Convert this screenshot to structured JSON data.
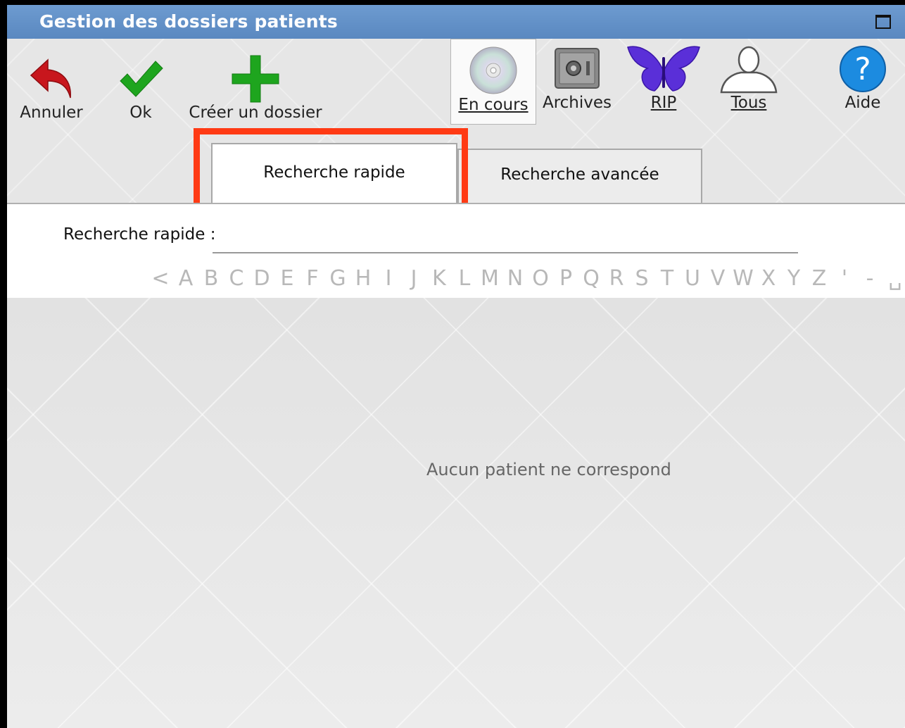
{
  "window": {
    "title": "Gestion des dossiers patients"
  },
  "toolbar": {
    "cancel_label": "Annuler",
    "ok_label": "Ok",
    "create_label": "Créer un dossier",
    "current_label": "En cours",
    "archives_label": "Archives",
    "rip_label": "RIP",
    "all_label": "Tous",
    "help_label": "Aide"
  },
  "tabs": {
    "quick": "Recherche rapide",
    "advanced": "Recherche avancée"
  },
  "search": {
    "label": "Recherche rapide :",
    "value": "",
    "alphabet": [
      "<",
      "A",
      "B",
      "C",
      "D",
      "E",
      "F",
      "G",
      "H",
      "I",
      "J",
      "K",
      "L",
      "M",
      "N",
      "O",
      "P",
      "Q",
      "R",
      "S",
      "T",
      "U",
      "V",
      "W",
      "X",
      "Y",
      "Z",
      "'",
      "-",
      "␣"
    ]
  },
  "results": {
    "empty_message": "Aucun patient ne correspond"
  },
  "colors": {
    "titlebar": "#5a88c0",
    "highlight": "#ff3a14",
    "cancel_icon": "#c8161d",
    "ok_icon": "#1ea51e",
    "create_icon": "#1ea51e",
    "rip_icon": "#5a2fd8",
    "help_icon": "#1c8be0"
  }
}
